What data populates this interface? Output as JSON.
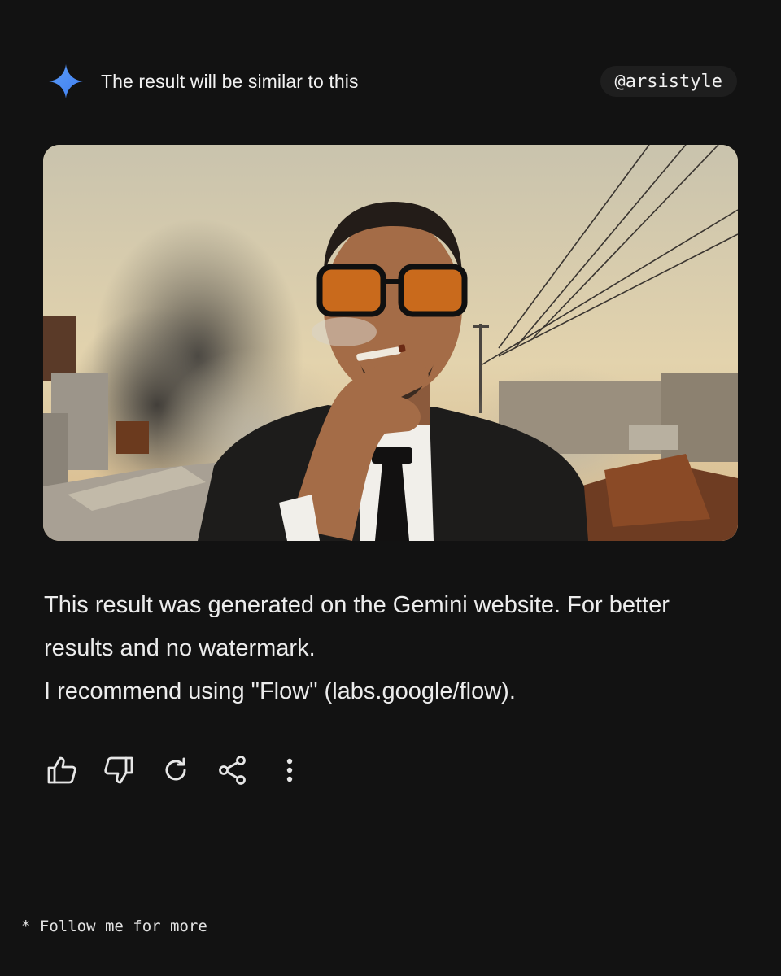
{
  "header": {
    "title": "The result will be similar to this",
    "handle": "@arsistyle",
    "icon": "gemini-sparkle-icon",
    "accent_color": "#4d8bf5"
  },
  "photo": {
    "icon": "generated-image"
  },
  "message": {
    "line1": "This result was generated on the Gemini website. For better results and no watermark.",
    "line2": "I recommend using \"Flow\" (labs.google/flow)."
  },
  "actions": [
    {
      "icon": "thumbs-up-icon"
    },
    {
      "icon": "thumbs-down-icon"
    },
    {
      "icon": "refresh-icon"
    },
    {
      "icon": "share-icon"
    },
    {
      "icon": "more-vertical-icon"
    }
  ],
  "footer": {
    "text": "* Follow me for more"
  }
}
